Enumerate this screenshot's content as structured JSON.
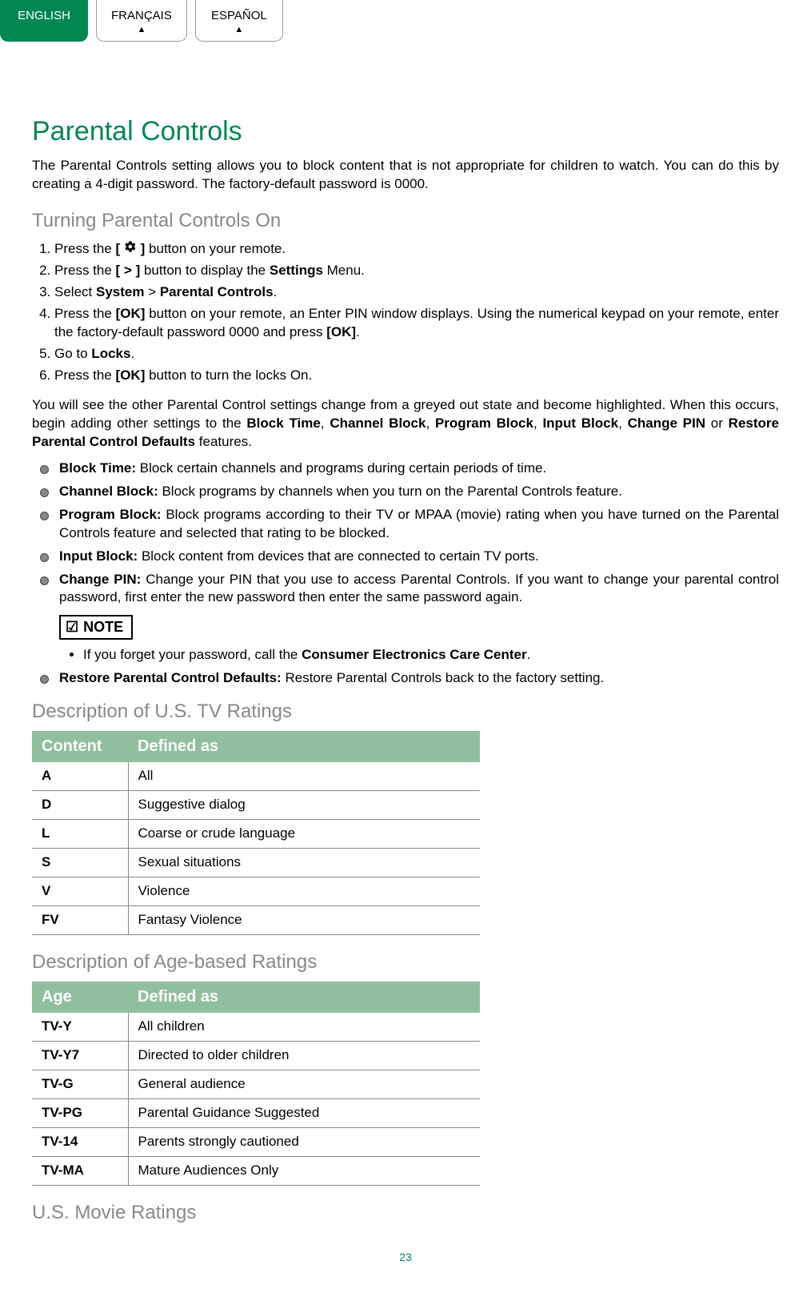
{
  "tabs": {
    "english": "ENGLISH",
    "francais": "FRANÇAIS",
    "espanol": "ESPAÑOL"
  },
  "title": "Parental Controls",
  "intro": "The Parental Controls setting allows you to block content that is not appropriate for children to watch. You can do this by creating a 4-digit password. The factory-default password is 0000.",
  "turning_on": {
    "heading": "Turning Parental Controls On",
    "step1_a": "Press the ",
    "step1_b": "[ ",
    "step1_c": " ]",
    "step1_d": " button on your remote.",
    "step2_a": "Press the ",
    "step2_b": "[ > ]",
    "step2_c": " button to display the ",
    "step2_d": "Settings",
    "step2_e": " Menu.",
    "step3_a": "Select ",
    "step3_b": "System",
    "step3_c": " > ",
    "step3_d": "Parental Controls",
    "step3_e": ".",
    "step4_a": "Press the ",
    "step4_b": "[OK]",
    "step4_c": " button on your remote, an Enter PIN window displays. Using the numerical keypad on your remote, enter the factory-default password 0000 and press ",
    "step4_d": "[OK]",
    "step4_e": ".",
    "step5_a": "Go to ",
    "step5_b": "Locks",
    "step5_c": ".",
    "step6_a": "Press the ",
    "step6_b": "[OK]",
    "step6_c": " button to turn the locks On."
  },
  "greyed_para_a": "You will see the other Parental Control settings change from a greyed out state and become highlighted. When this occurs, begin adding other settings to the ",
  "greyed_b1": "Block Time",
  "greyed_c1": ", ",
  "greyed_b2": "Channel Block",
  "greyed_c2": ", ",
  "greyed_b3": "Program Block",
  "greyed_c3": ", ",
  "greyed_b4": "Input Block",
  "greyed_c4": ", ",
  "greyed_b5": "Change PIN",
  "greyed_c5": " or ",
  "greyed_b6": "Restore Parental Control Defaults",
  "greyed_end": " features.",
  "bullets": {
    "block_time_t": "Block Time:",
    "block_time_d": " Block certain channels and programs during certain periods of time.",
    "channel_block_t": "Channel Block:",
    "channel_block_d": " Block programs by channels when you turn on the Parental Controls feature.",
    "program_block_t": "Program Block:",
    "program_block_d": " Block programs according to their TV or MPAA (movie) rating when you have turned on the Parental Controls feature and selected that rating to be blocked.",
    "input_block_t": "Input Block:",
    "input_block_d": " Block content from devices that are connected to certain TV ports.",
    "change_pin_t": "Change PIN:",
    "change_pin_d": " Change your PIN that you use to access Parental Controls. If you want to change your parental control password, first enter the new password then enter the same password again.",
    "restore_t": "Restore Parental Control Defaults:",
    "restore_d": " Restore Parental Controls back to the factory setting."
  },
  "note": {
    "label": "NOTE",
    "text_a": "If you forget your password, call the ",
    "text_b": "Consumer Electronics Care Center",
    "text_c": "."
  },
  "us_tv": {
    "heading": "Description of U.S. TV Ratings",
    "col1": "Content",
    "col2": "Defined as",
    "rows": [
      {
        "c": "A",
        "d": "All"
      },
      {
        "c": "D",
        "d": "Suggestive dialog"
      },
      {
        "c": "L",
        "d": "Coarse or crude language"
      },
      {
        "c": "S",
        "d": "Sexual situations"
      },
      {
        "c": "V",
        "d": "Violence"
      },
      {
        "c": "FV",
        "d": "Fantasy Violence"
      }
    ]
  },
  "age": {
    "heading": "Description of Age-based Ratings",
    "col1": "Age",
    "col2": "Defined as",
    "rows": [
      {
        "c": "TV-Y",
        "d": "All children"
      },
      {
        "c": "TV-Y7",
        "d": "Directed to older children"
      },
      {
        "c": "TV-G",
        "d": "General audience"
      },
      {
        "c": "TV-PG",
        "d": "Parental Guidance Suggested"
      },
      {
        "c": "TV-14",
        "d": "Parents strongly cautioned"
      },
      {
        "c": "TV-MA",
        "d": "Mature Audiences Only"
      }
    ]
  },
  "movie_heading": "U.S. Movie Ratings",
  "page_number": "23"
}
